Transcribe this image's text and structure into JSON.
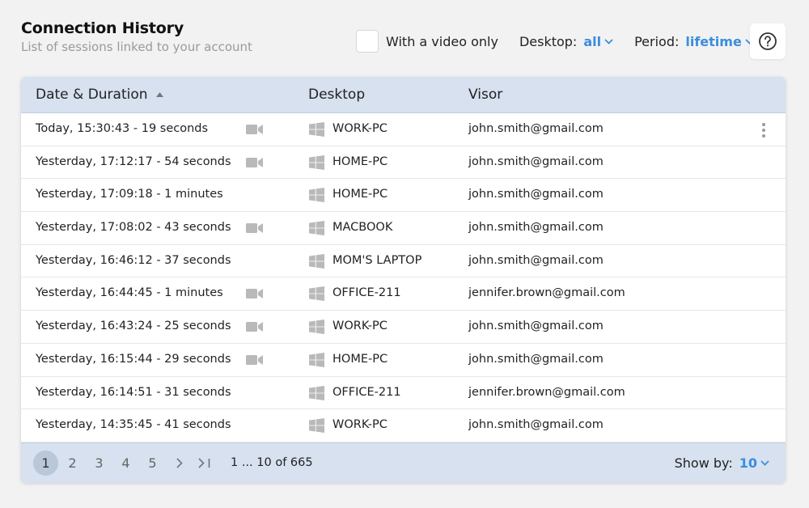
{
  "header": {
    "title": "Connection History",
    "subtitle": "List of sessions linked to your account"
  },
  "filters": {
    "video_only_label": "With a video only",
    "video_only_checked": false,
    "desktop_label": "Desktop:",
    "desktop_value": "all",
    "period_label": "Period:",
    "period_value": "lifetime"
  },
  "help_icon": "question-circle-icon",
  "table": {
    "columns": [
      "Date & Duration",
      "Desktop",
      "Visor"
    ],
    "sort_column": "Date & Duration",
    "sort_direction": "ascending",
    "rows": [
      {
        "date": "Today, 15:30:43 - 19 seconds",
        "video": true,
        "desktop": "WORK-PC",
        "visor": "john.smith@gmail.com",
        "menu": true
      },
      {
        "date": "Yesterday, 17:12:17 - 54 seconds",
        "video": true,
        "desktop": "HOME-PC",
        "visor": "john.smith@gmail.com",
        "menu": false
      },
      {
        "date": "Yesterday, 17:09:18 - 1 minutes",
        "video": false,
        "desktop": "HOME-PC",
        "visor": "john.smith@gmail.com",
        "menu": false
      },
      {
        "date": "Yesterday, 17:08:02 - 43 seconds",
        "video": true,
        "desktop": "MACBOOK",
        "visor": "john.smith@gmail.com",
        "menu": false
      },
      {
        "date": "Yesterday, 16:46:12 - 37 seconds",
        "video": false,
        "desktop": "MOM'S LAPTOP",
        "visor": "john.smith@gmail.com",
        "menu": false
      },
      {
        "date": "Yesterday, 16:44:45 - 1 minutes",
        "video": true,
        "desktop": "OFFICE-211",
        "visor": "jennifer.brown@gmail.com",
        "menu": false
      },
      {
        "date": "Yesterday, 16:43:24 - 25 seconds",
        "video": true,
        "desktop": "WORK-PC",
        "visor": "john.smith@gmail.com",
        "menu": false
      },
      {
        "date": "Yesterday, 16:15:44 - 29 seconds",
        "video": true,
        "desktop": "HOME-PC",
        "visor": "john.smith@gmail.com",
        "menu": false
      },
      {
        "date": "Yesterday, 16:14:51 - 31 seconds",
        "video": false,
        "desktop": "OFFICE-211",
        "visor": "jennifer.brown@gmail.com",
        "menu": false
      },
      {
        "date": "Yesterday, 14:35:45 - 41 seconds",
        "video": false,
        "desktop": "WORK-PC",
        "visor": "john.smith@gmail.com",
        "menu": false
      }
    ]
  },
  "pagination": {
    "pages": [
      "1",
      "2",
      "3",
      "4",
      "5"
    ],
    "current_page": "1",
    "range": "1 ... 10 of 665",
    "show_by_label": "Show by:",
    "show_by_value": "10"
  },
  "colors": {
    "accent": "#3a8dde",
    "header_bg": "#d7e1ef",
    "icon_gray": "#b9b9b9"
  }
}
